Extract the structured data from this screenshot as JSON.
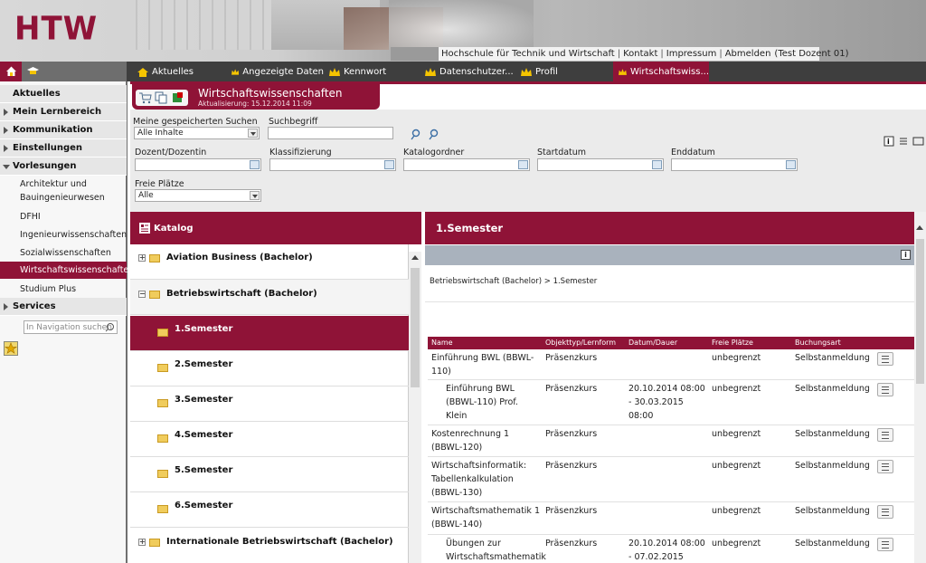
{
  "header": {
    "logo": "HTW",
    "links": [
      "Hochschule für Technik und Wirtschaft",
      "Kontakt",
      "Impressum",
      "Abmelden",
      "(Test Dozent 01)"
    ]
  },
  "tabs": [
    {
      "label": "Aktuelles",
      "icon": "home-icon"
    },
    {
      "label": "Angezeigte Daten",
      "icon": "crown-icon"
    },
    {
      "label": "Kennwort",
      "icon": "crown-icon"
    },
    {
      "label": "Datenschutzer...",
      "icon": "crown-icon"
    },
    {
      "label": "Profil",
      "icon": "crown-icon"
    },
    {
      "label": "Wirtschaftswiss...",
      "icon": "crown-icon",
      "active": true
    }
  ],
  "sidebar": {
    "items": [
      {
        "label": "Aktuelles"
      },
      {
        "label": "Mein Lernbereich"
      },
      {
        "label": "Kommunikation"
      },
      {
        "label": "Einstellungen"
      },
      {
        "label": "Vorlesungen"
      }
    ],
    "subitems": [
      {
        "label": "Architektur und"
      },
      {
        "label": "Bauingenieurwesen"
      },
      {
        "label": "DFHI"
      },
      {
        "label": "Ingenieurwissenschaften"
      },
      {
        "label": "Sozialwissenschaften"
      },
      {
        "label": "Wirtschaftswissenschafte",
        "active": true
      },
      {
        "label": "Studium Plus"
      }
    ],
    "services": "Services",
    "search_placeholder": "In Navigation suchen"
  },
  "main": {
    "title": "Wirtschaftswissenschaften",
    "subtitle": "Aktualisierung: 15.12.2014 11:09"
  },
  "form": {
    "saved_search_label": "Meine gespeicherten Suchen",
    "saved_search_value": "Alle Inhalte",
    "search_term_label": "Suchbegriff",
    "search_term_value": "",
    "dozent_label": "Dozent/Dozentin",
    "klass_label": "Klassifizierung",
    "katalog_label": "Katalogordner",
    "start_label": "Startdatum",
    "end_label": "Enddatum",
    "freie_label": "Freie Plätze",
    "freie_value": "Alle"
  },
  "catalog": {
    "title": "Katalog",
    "rows": [
      {
        "label": "Aviation Business (Bachelor)",
        "level": 0,
        "expander": "+"
      },
      {
        "label": "Betriebswirtschaft (Bachelor)",
        "level": 0,
        "expander": "−"
      },
      {
        "label": "1.Semester",
        "level": 1,
        "active": true
      },
      {
        "label": "2.Semester",
        "level": 1
      },
      {
        "label": "3.Semester",
        "level": 1
      },
      {
        "label": "4.Semester",
        "level": 1
      },
      {
        "label": "5.Semester",
        "level": 1
      },
      {
        "label": "6.Semester",
        "level": 1
      },
      {
        "label": "Internationale Betriebswirtschaft (Bachelor)",
        "level": 0,
        "expander": "+"
      }
    ]
  },
  "semester": {
    "title": "1.Semester",
    "breadcrumb": "Betriebswirtschaft (Bachelor) > 1.Semester"
  },
  "table": {
    "headers": [
      "Name",
      "Objekttyp/Lernform",
      "Datum/Dauer",
      "Freie Plätze",
      "Buchungsart"
    ],
    "rows": [
      {
        "name": "Einführung BWL (BBWL-110)",
        "type": "Präsenzkurs",
        "date": "",
        "free": "unbegrenzt",
        "booking": "Selbstanmeldung",
        "indent": false
      },
      {
        "name": "Einführung BWL (BBWL-110) Prof. Klein",
        "type": "Präsenzkurs",
        "date": "20.10.2014 08:00 - 30.03.2015 08:00",
        "free": "unbegrenzt",
        "booking": "Selbstanmeldung",
        "indent": true
      },
      {
        "name": "Kostenrechnung 1 (BBWL-120)",
        "type": "Präsenzkurs",
        "date": "",
        "free": "unbegrenzt",
        "booking": "Selbstanmeldung",
        "indent": false
      },
      {
        "name": "Wirtschaftsinformatik: Tabellenkalkulation (BBWL-130)",
        "type": "Präsenzkurs",
        "date": "",
        "free": "unbegrenzt",
        "booking": "Selbstanmeldung",
        "indent": false
      },
      {
        "name": "Wirtschaftsmathematik 1 (BBWL-140)",
        "type": "Präsenzkurs",
        "date": "",
        "free": "unbegrenzt",
        "booking": "Selbstanmeldung",
        "indent": false
      },
      {
        "name": "Übungen zur Wirtschaftsmathematik",
        "type": "Präsenzkurs",
        "date": "20.10.2014 08:00 - 07.02.2015",
        "free": "unbegrenzt",
        "booking": "Selbstanmeldung",
        "indent": true
      }
    ]
  },
  "colors": {
    "accent": "#8f1337",
    "tabbar": "#3e3e3e"
  }
}
